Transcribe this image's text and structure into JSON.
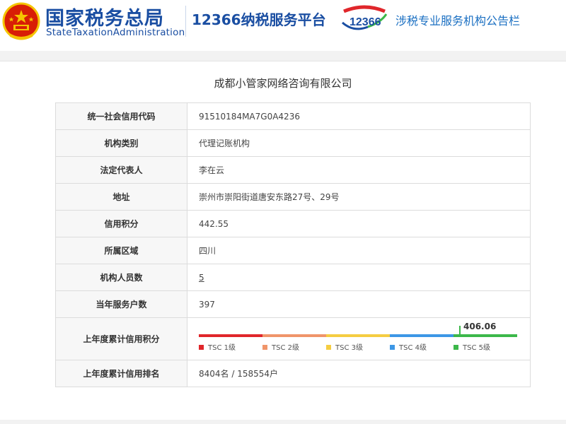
{
  "header": {
    "brand_cn": "国家税务总局",
    "brand_en": "StateTaxationAdministration",
    "platform": "12366纳税服务平台",
    "logo_text": "12366",
    "bulletin": "涉税专业服务机构公告栏"
  },
  "company": {
    "name": "成都小管家网络咨询有限公司"
  },
  "rows": [
    {
      "label": "统一社会信用代码",
      "value": "91510184MA7G0A4236"
    },
    {
      "label": "机构类别",
      "value": "代理记账机构"
    },
    {
      "label": "法定代表人",
      "value": "李在云"
    },
    {
      "label": "地址",
      "value": "崇州市崇阳街道唐安东路27号、29号"
    },
    {
      "label": "信用积分",
      "value": "442.55"
    },
    {
      "label": "所属区域",
      "value": "四川"
    },
    {
      "label": "机构人员数",
      "value": "5"
    },
    {
      "label": "当年服务户数",
      "value": "397"
    },
    {
      "label": "上年度累计信用积分",
      "value": "406.06"
    },
    {
      "label": "上年度累计信用排名",
      "value": "8404名 / 158554户"
    }
  ],
  "score_bar": {
    "value": 406.06,
    "levels": [
      {
        "name": "TSC 1级",
        "color": "#e0262b"
      },
      {
        "name": "TSC 2级",
        "color": "#f0956a"
      },
      {
        "name": "TSC 3级",
        "color": "#f5cd42"
      },
      {
        "name": "TSC 4级",
        "color": "#3d97e6"
      },
      {
        "name": "TSC 5级",
        "color": "#3cb84a"
      }
    ]
  },
  "colors": {
    "brand_blue": "#1a4ea2",
    "emblem_red": "#d81e06",
    "emblem_gold": "#f5c400"
  }
}
